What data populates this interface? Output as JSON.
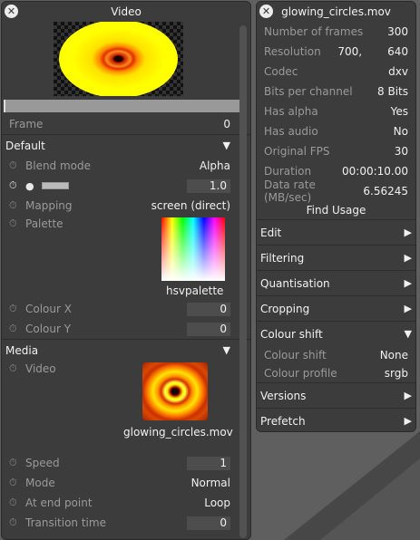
{
  "left_panel": {
    "title": "Video",
    "frame": {
      "label": "Frame",
      "value": "0"
    },
    "default_section": {
      "title": "Default",
      "blend_mode": {
        "label": "Blend mode",
        "value": "Alpha"
      },
      "opacity_value": "1.0",
      "mapping": {
        "label": "Mapping",
        "value": "screen (direct)"
      },
      "palette": {
        "label": "Palette",
        "name": "hsvpalette"
      },
      "colour_x": {
        "label": "Colour X",
        "value": "0"
      },
      "colour_y": {
        "label": "Colour Y",
        "value": "0"
      }
    },
    "media_section": {
      "title": "Media",
      "video": {
        "label": "Video",
        "filename": "glowing_circles.mov"
      },
      "speed": {
        "label": "Speed",
        "value": "1"
      },
      "mode": {
        "label": "Mode",
        "value": "Normal"
      },
      "at_end_point": {
        "label": "At end point",
        "value": "Loop"
      },
      "transition_time": {
        "label": "Transition time",
        "value": "0"
      }
    }
  },
  "right_panel": {
    "title": "glowing_circles.mov",
    "info": [
      {
        "label": "Number of frames",
        "value": "300"
      },
      {
        "label": "Resolution",
        "value": "700,",
        "value2": "640"
      },
      {
        "label": "Codec",
        "value": "dxv"
      },
      {
        "label": "Bits per channel",
        "value": "8 Bits"
      },
      {
        "label": "Has alpha",
        "value": "Yes"
      },
      {
        "label": "Has audio",
        "value": "No"
      },
      {
        "label": "Original FPS",
        "value": "30"
      },
      {
        "label": "Duration",
        "value": "00:00:10.00"
      },
      {
        "label": "Data rate (MB/sec)",
        "value": "6.56245"
      }
    ],
    "find_usage": "Find Usage",
    "sections": {
      "edit": "Edit",
      "filtering": "Filtering",
      "quantisation": "Quantisation",
      "cropping": "Cropping",
      "colour_shift": "Colour shift",
      "versions": "Versions",
      "prefetch": "Prefetch"
    },
    "colour_shift_rows": {
      "colour_shift": {
        "label": "Colour shift",
        "value": "None"
      },
      "colour_profile": {
        "label": "Colour profile",
        "value": "srgb"
      }
    }
  },
  "icons": {
    "close": "✕",
    "stopwatch": "⏱",
    "bulb": "💡",
    "arrow_right": "▶",
    "arrow_down": "▼"
  },
  "colors": {
    "panel_bg": "#3c3c3c",
    "desktop_bg": "#5f5f5f",
    "text": "#e8e8e8",
    "muted_text": "#9a9a9a",
    "preview_yellow": "#ffff00"
  }
}
